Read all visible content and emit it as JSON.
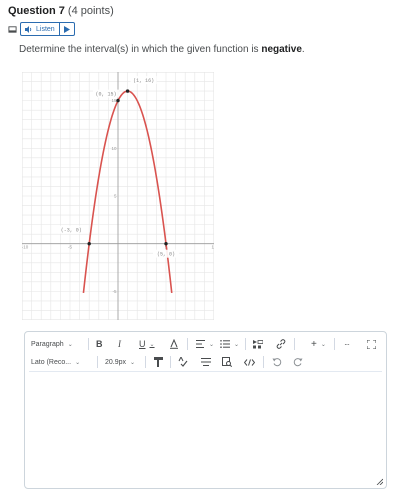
{
  "question": {
    "title": "Question 7",
    "points": "(4 points)"
  },
  "listen": {
    "label": "Listen"
  },
  "prompt": {
    "text_before": "Determine the interval(s) in which the given function is ",
    "text_bold": "negative",
    "text_after": "."
  },
  "graph": {
    "x_ticks": [
      "-10",
      "-5",
      "5",
      "10"
    ],
    "y_ticks": [
      "15",
      "10",
      "5",
      "-5"
    ],
    "point_labels": [
      "(1, 16)",
      "(0, 15)",
      "(-3, 0)",
      "(5, 0)"
    ],
    "curve_color": "#d9534f"
  },
  "chart_data": {
    "type": "line",
    "title": "",
    "xlabel": "",
    "ylabel": "",
    "xlim": [
      -10,
      10
    ],
    "ylim": [
      -8,
      18
    ],
    "grid": true,
    "function": "-(x+3)(x-5)",
    "series": [
      {
        "x": [
          -3.6,
          -3,
          -2,
          -1,
          0,
          1,
          2,
          3,
          4,
          5,
          5.6
        ],
        "y": [
          -5.16,
          0,
          7,
          12,
          15,
          16,
          15,
          12,
          7,
          0,
          -5.16
        ]
      }
    ],
    "points": [
      {
        "x": 1,
        "y": 16,
        "label": "(1, 16)"
      },
      {
        "x": 0,
        "y": 15,
        "label": "(0, 15)"
      },
      {
        "x": -3,
        "y": 0,
        "label": "(-3, 0)"
      },
      {
        "x": 5,
        "y": 0,
        "label": "(5, 0)"
      }
    ]
  },
  "editor": {
    "paragraph": "Paragraph",
    "font": "Lato (Reco...",
    "size": "20.9px",
    "bold": "B",
    "italic": "I",
    "underline": "U",
    "plus": "+",
    "more": "···"
  }
}
